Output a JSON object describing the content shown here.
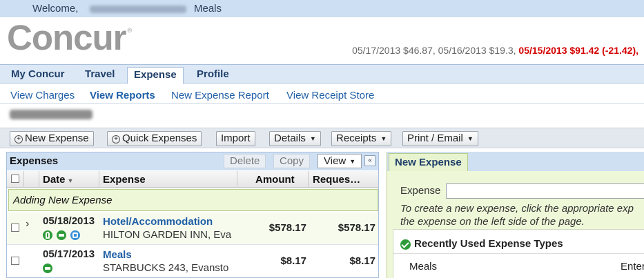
{
  "topbar": {
    "welcome": "Welcome,",
    "current_context": "Meals"
  },
  "header": {
    "logo": "Concur",
    "recent_normal": "05/17/2013 $46.87, 05/16/2013 $19.3, ",
    "recent_highlight": "05/15/2013 $91.42 (-21.42),"
  },
  "nav": {
    "tabs": [
      {
        "label": "My Concur"
      },
      {
        "label": "Travel"
      },
      {
        "label": "Expense",
        "active": true
      },
      {
        "label": "Profile"
      }
    ]
  },
  "subnav": {
    "links": [
      {
        "label": "View Charges"
      },
      {
        "label": "View Reports",
        "active": true
      },
      {
        "label": "New Expense Report"
      },
      {
        "label": "View Receipt Store"
      }
    ]
  },
  "toolbar": {
    "new_expense": "New Expense",
    "quick_expenses": "Quick Expenses",
    "import": "Import",
    "details": "Details",
    "receipts": "Receipts",
    "print_email": "Print / Email"
  },
  "expenses_panel": {
    "title": "Expenses",
    "delete": "Delete",
    "copy": "Copy",
    "view": "View",
    "columns": {
      "date": "Date",
      "expense": "Expense",
      "amount": "Amount",
      "requested": "Reques…"
    },
    "adding_text": "Adding New Expense",
    "rows": [
      {
        "date": "05/18/2013",
        "type": "Hotel/Accommodation",
        "vendor": "HILTON GARDEN INN, Eva",
        "amount": "$578.17",
        "requested": "$578.17"
      },
      {
        "date": "05/17/2013",
        "type": "Meals",
        "vendor": "STARBUCKS 243, Evansto",
        "amount": "$8.17",
        "requested": "$8.17"
      }
    ]
  },
  "new_expense_panel": {
    "tab": "New Expense",
    "expense_label": "Expense",
    "help_line1": "To create a new expense, click the appropriate exp",
    "help_line2": "the expense on the left side of the page.",
    "recent_heading": "Recently Used Expense Types",
    "recent_item1": "Meals",
    "recent_item2": "Enter"
  },
  "colors": {
    "accent_blue": "#1f5fa6",
    "header_bg": "#cddff2",
    "highlight_red": "#d40000",
    "adding_bg": "#eef7d8"
  }
}
